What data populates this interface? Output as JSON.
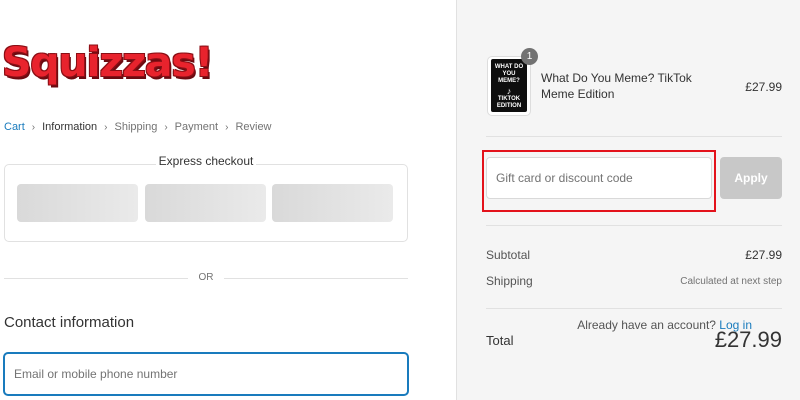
{
  "store": {
    "logo_text": "Squizzas!"
  },
  "breadcrumb": {
    "items": [
      "Cart",
      "Information",
      "Shipping",
      "Payment",
      "Review"
    ],
    "separator": "›"
  },
  "express_checkout": {
    "title": "Express checkout"
  },
  "divider": {
    "or_text": "OR"
  },
  "contact": {
    "title": "Contact information",
    "account_prompt": "Already have an account?",
    "login_link": "Log in",
    "email_placeholder": "Email or mobile phone number",
    "email_value": ""
  },
  "order_summary": {
    "product": {
      "quantity_badge": "1",
      "name": "What Do You Meme? TikTok Meme Edition",
      "price": "£27.99",
      "box_art": {
        "line1": "WHAT DO YOU",
        "line2": "MEME?",
        "line3": "TIKTOK EDITION"
      }
    },
    "discount": {
      "placeholder": "Gift card or discount code",
      "value": "",
      "apply_label": "Apply"
    },
    "subtotal": {
      "label": "Subtotal",
      "value": "£27.99"
    },
    "shipping": {
      "label": "Shipping",
      "value": "Calculated at next step"
    },
    "total": {
      "label": "Total",
      "value": "£27.99"
    }
  },
  "colors": {
    "brand_red": "#e8232d",
    "link_blue": "#197bbd",
    "highlight_red": "#e3121b",
    "apply_disabled": "#c8c8c8"
  }
}
